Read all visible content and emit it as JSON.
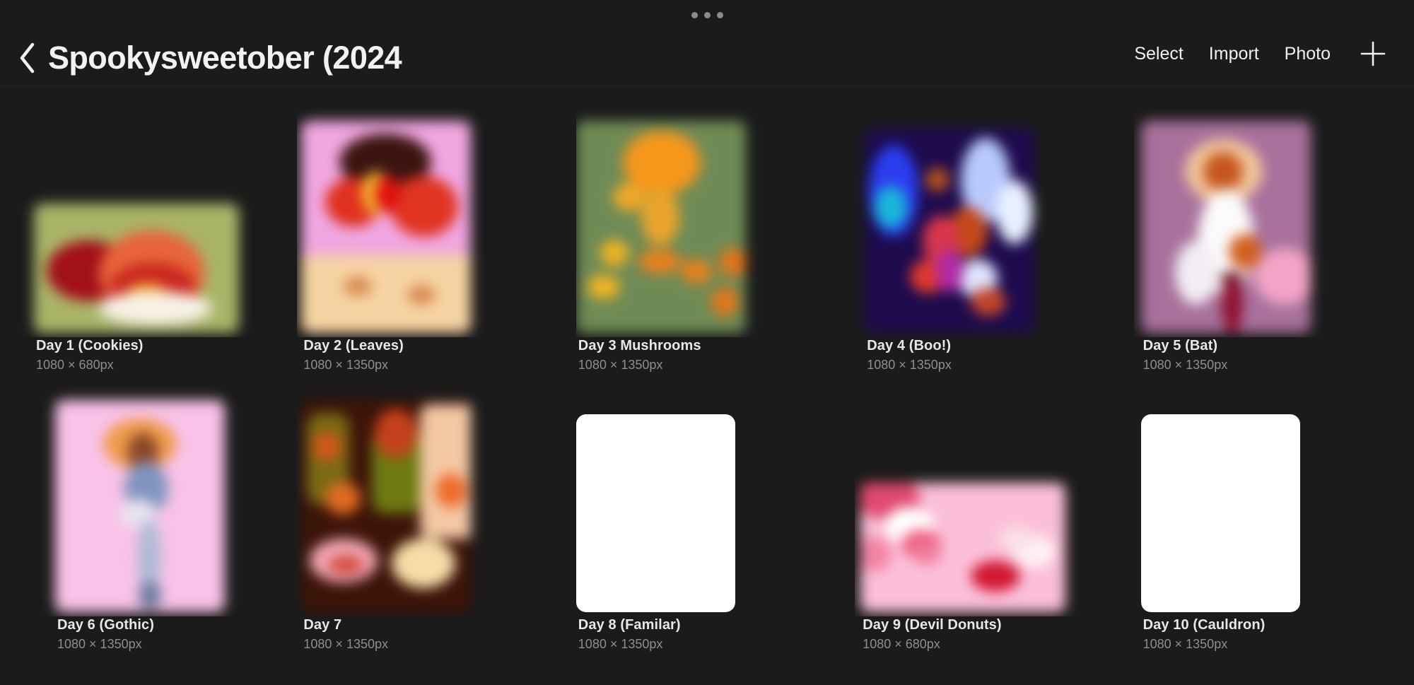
{
  "window": {
    "drag_handle_dots": 3,
    "background": "#1b1b1b"
  },
  "header": {
    "back_icon": "chevron-left-icon",
    "title": "Spookysweetober (2024",
    "actions": [
      {
        "label": "Select",
        "name": "select-button"
      },
      {
        "label": "Import",
        "name": "import-button"
      },
      {
        "label": "Photo",
        "name": "photo-button"
      }
    ],
    "add_icon": "plus-icon"
  },
  "gallery": {
    "rows": [
      {
        "items": [
          {
            "title": "Day 1 (Cookies)",
            "dimensions": "1080 × 680px",
            "orientation": "landscape",
            "blank": false,
            "bg": "#a9b468",
            "accent": "#c0392b"
          },
          {
            "title": "Day 2 (Leaves)",
            "dimensions": "1080 × 1350px",
            "orientation": "portrait",
            "blank": false,
            "bg": "#f0a6e0",
            "accent": "#e0301e"
          },
          {
            "title": "Day 3 Mushrooms",
            "dimensions": "1080 × 1350px",
            "orientation": "portrait",
            "blank": false,
            "bg": "#6f8b55",
            "accent": "#f08a00"
          },
          {
            "title": "Day 4 (Boo!)",
            "dimensions": "1080 × 1350px",
            "orientation": "portrait",
            "blank": false,
            "bg": "#1f0f54",
            "accent": "#3a5bff"
          },
          {
            "title": "Day 5 (Bat)",
            "dimensions": "1080 × 1350px",
            "orientation": "portrait",
            "blank": false,
            "bg": "#a8719c",
            "accent": "#ffffff"
          }
        ]
      },
      {
        "items": [
          {
            "title": "Day 6 (Gothic)",
            "dimensions": "1080 × 1350px",
            "orientation": "portrait",
            "blank": false,
            "bg": "#f9c2e8",
            "accent": "#e98a3c"
          },
          {
            "title": "Day 7",
            "dimensions": "1080 × 1350px",
            "orientation": "portrait",
            "blank": false,
            "bg": "#3a1508",
            "accent": "#d9591f"
          },
          {
            "title": "Day 8 (Familar)",
            "dimensions": "1080 × 1350px",
            "orientation": "portrait",
            "blank": true,
            "bg": "#ffffff",
            "accent": "#ffffff"
          },
          {
            "title": "Day 9 (Devil Donuts)",
            "dimensions": "1080 × 680px",
            "orientation": "landscape",
            "blank": false,
            "bg": "#fbbfd8",
            "accent": "#e0203f"
          },
          {
            "title": "Day 10 (Cauldron)",
            "dimensions": "1080 × 1350px",
            "orientation": "portrait",
            "blank": true,
            "bg": "#ffffff",
            "accent": "#ffffff"
          }
        ]
      }
    ]
  }
}
